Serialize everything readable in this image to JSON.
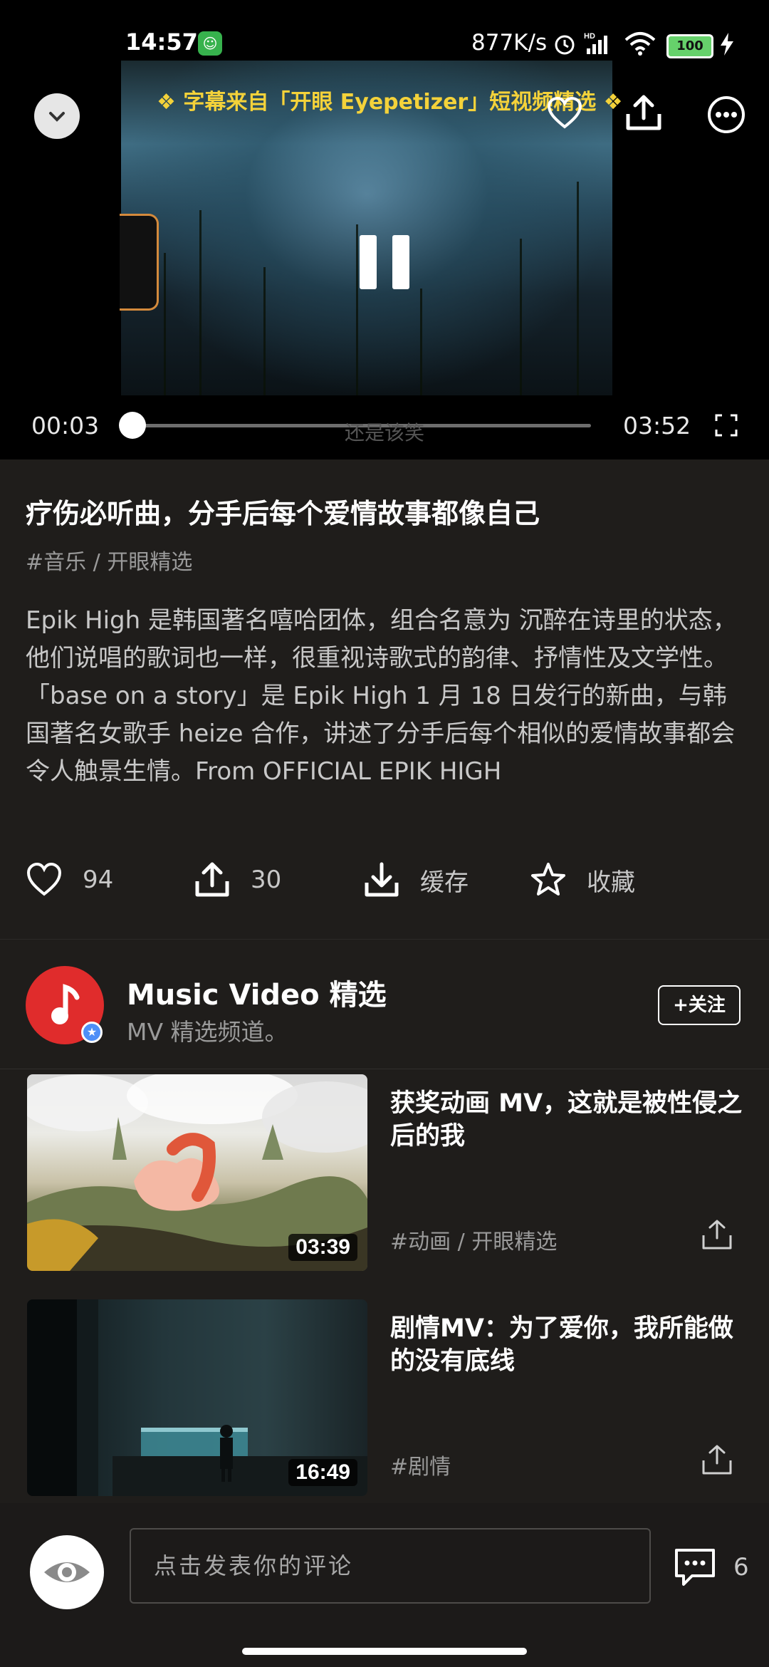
{
  "status_bar": {
    "time": "14:57",
    "network_speed": "877K/s",
    "battery": "100",
    "icons": [
      "app-notification-icon",
      "alarm-icon",
      "hd-signal-icon",
      "wifi-icon",
      "battery-icon",
      "charging-icon"
    ]
  },
  "player": {
    "subtitle_banner": "❖ 字幕来自「开眼 Eyepetizer」短视频精选 ❖",
    "current_time": "00:03",
    "total_time": "03:52",
    "lyric": "还是该笑",
    "progress": 0.014,
    "icons": [
      "chevron-down-icon",
      "heart-icon",
      "share-icon",
      "more-icon",
      "pause-icon",
      "fullscreen-icon"
    ]
  },
  "video": {
    "title": "疗伤必听曲，分手后每个爱情故事都像自己",
    "tags": "#音乐 / 开眼精选",
    "description": "Epik High 是韩国著名嘻哈团体，组合名意为 沉醉在诗里的状态，他们说唱的歌词也一样，很重视诗歌式的韵律、抒情性及文学性。「base on a story」是 Epik High 1 月 18 日发行的新曲，与韩国著名女歌手 heize 合作，讲述了分手后每个相似的爱情故事都会令人触景生情。From OFFICIAL EPIK HIGH"
  },
  "actions": {
    "like_count": "94",
    "share_count": "30",
    "cache_label": "缓存",
    "favorite_label": "收藏"
  },
  "channel": {
    "name": "Music Video 精选",
    "description": "MV 精选频道。",
    "follow_label": "+关注"
  },
  "related": [
    {
      "title": "获奖动画 MV，这就是被性侵之后的我",
      "duration": "03:39",
      "tag": "#动画 / 开眼精选"
    },
    {
      "title": "剧情MV：为了爱你，我所能做的没有底线",
      "duration": "16:49",
      "tag": "#剧情"
    }
  ],
  "comment_bar": {
    "placeholder": "点击发表你的评论",
    "comment_count": "6"
  },
  "colors": {
    "background": "#1f1d1b",
    "banner_yellow": "#f4d23a",
    "channel_red": "#e02c2c",
    "badge_blue": "#4f8ff7"
  }
}
